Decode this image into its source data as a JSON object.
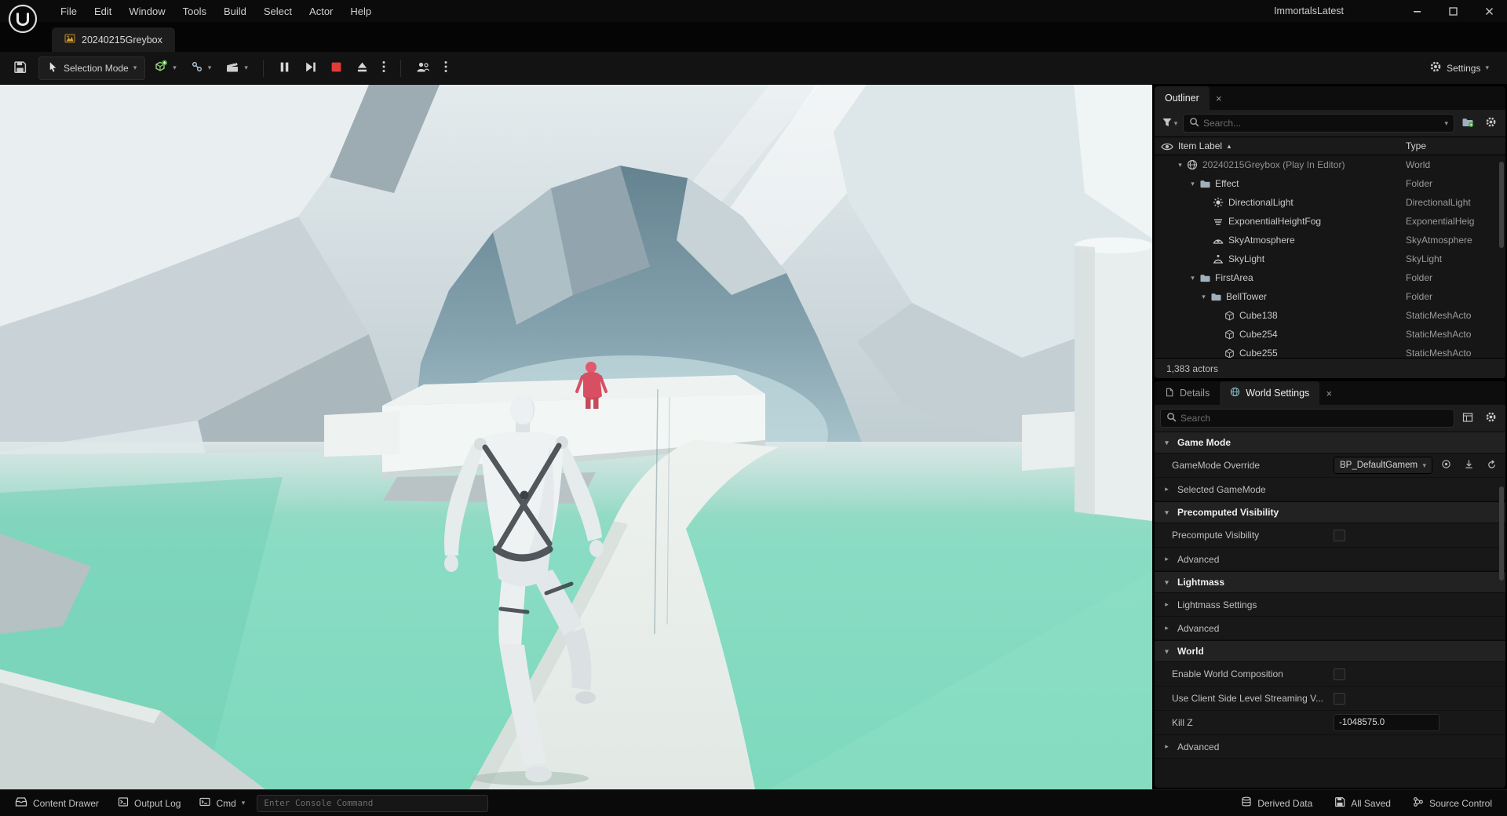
{
  "icons": {
    "caret_down": "▾",
    "caret_right": "▸",
    "sort_asc": "▲",
    "close": "×"
  },
  "colors": {
    "stop_red": "#e23b3b",
    "floor_teal": "#7ed9bd",
    "enemy_red": "#d84f63",
    "tab_icon_orange": "#d9a33c",
    "add_green": "#46a33c"
  },
  "menubar": {
    "items": [
      "File",
      "Edit",
      "Window",
      "Tools",
      "Build",
      "Select",
      "Actor",
      "Help"
    ],
    "window_title": "ImmortalsLatest"
  },
  "tabbar": {
    "asset_tab": "20240215Greybox"
  },
  "toolbar": {
    "selection_mode": "Selection Mode",
    "settings": "Settings"
  },
  "outliner": {
    "title": "Outliner",
    "search_placeholder": "Search...",
    "columns": {
      "item": "Item Label",
      "type": "Type"
    },
    "rows": [
      {
        "label": "20240215Greybox (Play In Editor)",
        "type": "World"
      },
      {
        "label": "Effect",
        "type": "Folder"
      },
      {
        "label": "DirectionalLight",
        "type": "DirectionalLight"
      },
      {
        "label": "ExponentialHeightFog",
        "type": "ExponentialHeig"
      },
      {
        "label": "SkyAtmosphere",
        "type": "SkyAtmosphere"
      },
      {
        "label": "SkyLight",
        "type": "SkyLight"
      },
      {
        "label": "FirstArea",
        "type": "Folder"
      },
      {
        "label": "BellTower",
        "type": "Folder"
      },
      {
        "label": "Cube138",
        "type": "StaticMeshActo"
      },
      {
        "label": "Cube254",
        "type": "StaticMeshActo"
      },
      {
        "label": "Cube255",
        "type": "StaticMeshActo"
      }
    ],
    "actor_count": "1,383 actors"
  },
  "details": {
    "tabs": {
      "details": "Details",
      "world_settings": "World Settings"
    },
    "search_placeholder": "Search",
    "rows": [
      {
        "label": "Game Mode"
      },
      {
        "label": "GameMode Override",
        "value": "BP_DefaultGamem"
      },
      {
        "label": "Selected GameMode"
      },
      {
        "label": "Precomputed Visibility"
      },
      {
        "label": "Precompute Visibility"
      },
      {
        "label": "Advanced"
      },
      {
        "label": "Lightmass"
      },
      {
        "label": "Lightmass Settings"
      },
      {
        "label": "Advanced"
      },
      {
        "label": "World"
      },
      {
        "label": "Enable World Composition"
      },
      {
        "label": "Use Client Side Level Streaming V..."
      },
      {
        "label": "Kill Z",
        "value": "-1048575.0"
      },
      {
        "label": "Advanced"
      }
    ]
  },
  "statusbar": {
    "content_drawer": "Content Drawer",
    "output_log": "Output Log",
    "cmd": "Cmd",
    "console_placeholder": "Enter Console Command",
    "derived_data": "Derived Data",
    "all_saved": "All Saved",
    "source_control": "Source Control"
  }
}
